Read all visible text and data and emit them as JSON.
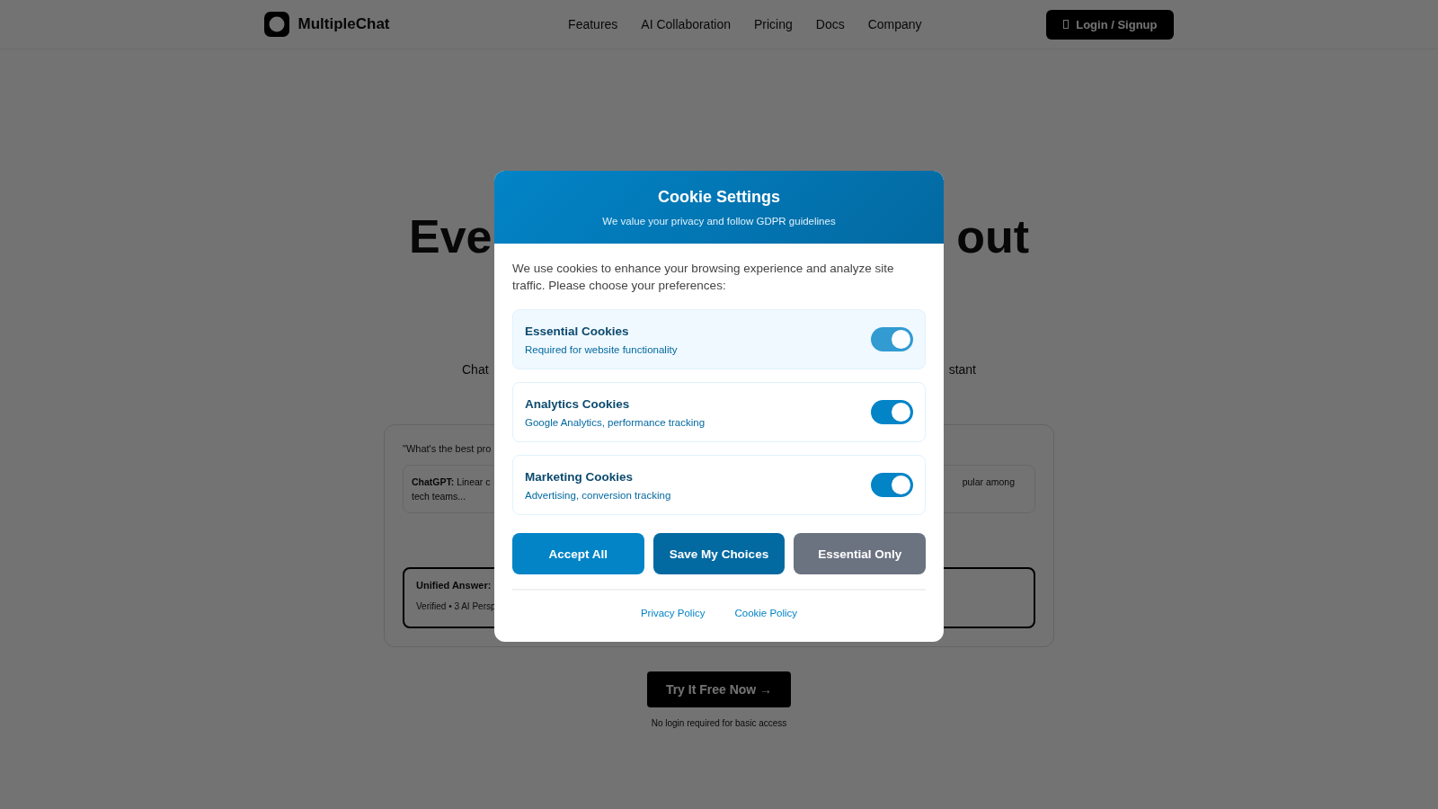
{
  "nav": {
    "logo": "MultipleChat",
    "links": [
      "Features",
      "AI Collaboration",
      "Pricing",
      "Docs",
      "Company"
    ],
    "login_button": "Login / Signup"
  },
  "hero": {
    "headline_left": "Eve",
    "headline_right": "out",
    "subtitle_left": "Chat",
    "subtitle_right": "stant"
  },
  "demo": {
    "question": "\"What's the best pro",
    "answer": {
      "label": "ChatGPT:",
      "text_left": "Linear c",
      "text_right": "pular among",
      "text_continued": "tech teams..."
    },
    "unified": {
      "label": "Unified Answer:",
      "meta": "Verified • 3 AI Persp"
    }
  },
  "cta": {
    "button": "Try It Free Now →",
    "note": "No login required for basic access"
  },
  "modal": {
    "title": "Cookie Settings",
    "subtitle": "We value your privacy and follow GDPR guidelines",
    "intro": "We use cookies to enhance your browsing experience and analyze site traffic. Please choose your preferences:",
    "options": [
      {
        "name": "Essential Cookies",
        "description": "Required for website functionality",
        "checked": true,
        "disabled": true
      },
      {
        "name": "Analytics Cookies",
        "description": "Google Analytics, performance tracking",
        "checked": true,
        "disabled": false
      },
      {
        "name": "Marketing Cookies",
        "description": "Advertising, conversion tracking",
        "checked": true,
        "disabled": false
      }
    ],
    "buttons": [
      {
        "label": "Accept All",
        "kind": "accept"
      },
      {
        "label": "Save My Choices",
        "kind": "save"
      },
      {
        "label": "Essential Only",
        "kind": "essential"
      }
    ],
    "links": [
      "Privacy Policy",
      "Cookie Policy"
    ]
  }
}
